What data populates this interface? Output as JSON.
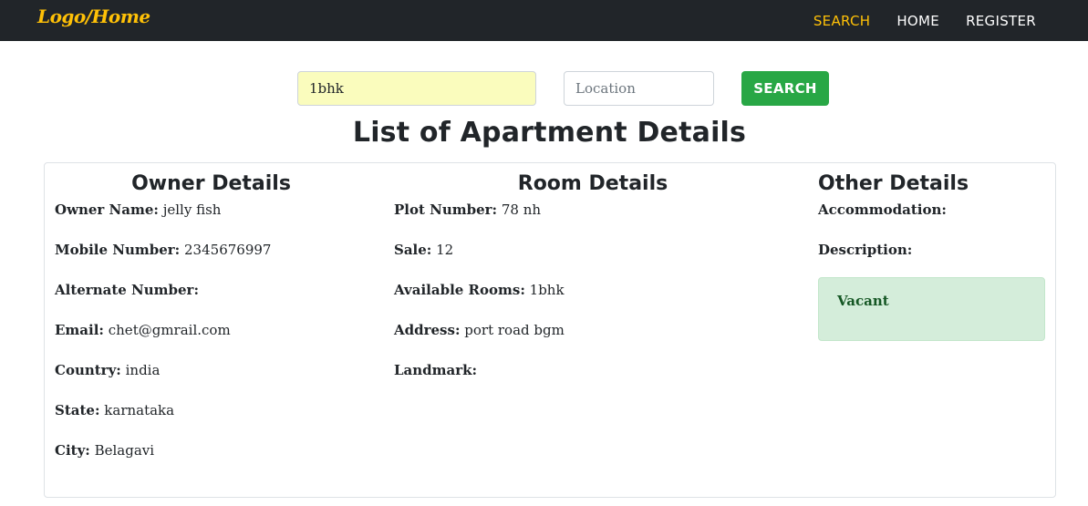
{
  "nav": {
    "brand": "Logo/Home",
    "links": [
      "SEARCH",
      "HOME",
      "REGISTER"
    ]
  },
  "search": {
    "query_value": "1bhk",
    "location_placeholder": "Location",
    "button_label": "SEARCH"
  },
  "page_title": "List of Apartment Details",
  "owner": {
    "heading": "Owner Details",
    "fields": [
      {
        "label": "Owner Name:",
        "value": "jelly fish"
      },
      {
        "label": "Mobile Number:",
        "value": "2345676997"
      },
      {
        "label": "Alternate Number:",
        "value": ""
      },
      {
        "label": "Email:",
        "value": "chet@gmrail.com"
      },
      {
        "label": "Country:",
        "value": "india"
      },
      {
        "label": "State:",
        "value": "karnataka"
      },
      {
        "label": "City:",
        "value": "Belagavi"
      }
    ]
  },
  "room": {
    "heading": "Room Details",
    "fields": [
      {
        "label": "Plot Number:",
        "value": "78 nh"
      },
      {
        "label": "Sale:",
        "value": "12"
      },
      {
        "label": "Available Rooms:",
        "value": "1bhk"
      },
      {
        "label": "Address:",
        "value": "port road bgm"
      },
      {
        "label": "Landmark:",
        "value": ""
      }
    ]
  },
  "other": {
    "heading": "Other Details",
    "fields": [
      {
        "label": "Accommodation:",
        "value": ""
      },
      {
        "label": "Description:",
        "value": ""
      }
    ],
    "status": "Vacant"
  },
  "colors": {
    "navbar_bg": "#212529",
    "accent": "#ffc107",
    "search_button": "#28a745",
    "status_bg": "#d4edda",
    "status_text": "#155724"
  }
}
